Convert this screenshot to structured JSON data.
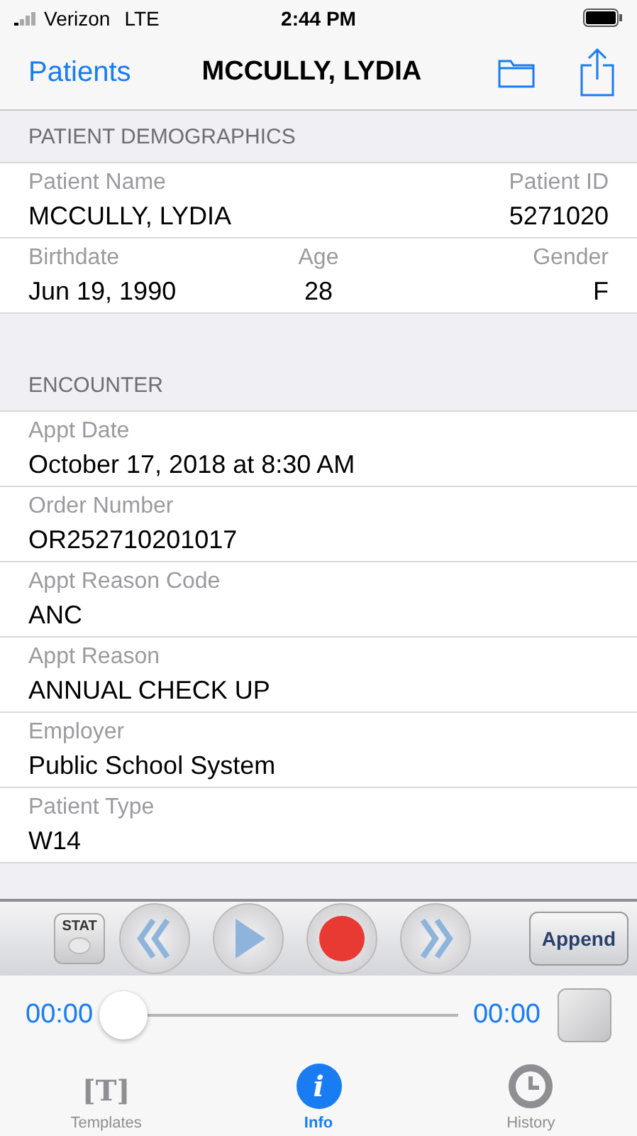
{
  "status_bar": {
    "carrier": "Verizon",
    "network": "LTE",
    "time": "2:44 PM"
  },
  "nav": {
    "back": "Patients",
    "title": "MCCULLY, LYDIA"
  },
  "sections": [
    {
      "title": "PATIENT DEMOGRAPHICS",
      "rows": [
        {
          "fields": [
            {
              "label": "Patient Name",
              "value": "MCCULLY, LYDIA"
            },
            {
              "label": "Patient ID",
              "value": "5271020"
            }
          ]
        },
        {
          "fields": [
            {
              "label": "Birthdate",
              "value": "Jun 19, 1990"
            },
            {
              "label": "Age",
              "value": "28"
            },
            {
              "label": "Gender",
              "value": "F"
            }
          ]
        }
      ]
    },
    {
      "title": "ENCOUNTER",
      "rows": [
        {
          "fields": [
            {
              "label": "Appt Date",
              "value": "October 17, 2018 at 8:30 AM"
            }
          ]
        },
        {
          "fields": [
            {
              "label": "Order Number",
              "value": "OR252710201017"
            }
          ]
        },
        {
          "fields": [
            {
              "label": "Appt Reason Code",
              "value": "ANC"
            }
          ]
        },
        {
          "fields": [
            {
              "label": "Appt Reason",
              "value": "ANNUAL CHECK UP"
            }
          ]
        },
        {
          "fields": [
            {
              "label": "Employer",
              "value": "Public School System"
            }
          ]
        },
        {
          "fields": [
            {
              "label": "Patient Type",
              "value": "W14"
            }
          ]
        }
      ]
    }
  ],
  "recorder": {
    "stat": "STAT",
    "append": "Append",
    "elapsed": "00:00",
    "total": "00:00",
    "level": 0
  },
  "tabs": [
    {
      "label": "Templates",
      "kind": "templates",
      "glyph": "[T]",
      "selected": false
    },
    {
      "label": "Info",
      "kind": "info",
      "glyph": "i",
      "selected": true
    },
    {
      "label": "History",
      "kind": "history",
      "selected": false
    }
  ]
}
